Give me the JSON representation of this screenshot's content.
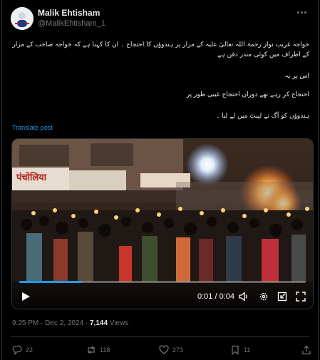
{
  "author": {
    "name": "Malik Ehtisham",
    "handle": "@MalikEhtisham_1"
  },
  "post": {
    "lines": [
      "خواجہ غریب نواز رحمۃ اللہ تعالیٰ علیہ کے مزار پر ہندوؤں کا احتجاج ۔ ان کا کہنا ہے کہ خواجہ صاحب کے مزار کے اطراف میں کوئی مندر دفن ہے",
      "اس پر یہ",
      "احتجاج کر رہے تھے دوران احتجاج غیبی طور پر",
      "ہندوؤں کو آگ نے لپیٹ میں لے لیا ۔"
    ],
    "translate_label": "Translate post"
  },
  "video": {
    "time_label": "0:01 / 0:04",
    "progress": 0.22,
    "sign_text": "पंचोलिया"
  },
  "meta": {
    "time": "9:25 PM",
    "sep": "·",
    "date": "Dec 2, 2024",
    "views_count": "7,144",
    "views_label": "Views"
  },
  "actions": {
    "replies": "22",
    "reposts": "118",
    "likes": "273",
    "bookmarks": "11"
  },
  "colors": {
    "accent": "#1d9bf0",
    "muted": "#71767b",
    "text": "#e7e9ea",
    "border": "#2f3336"
  }
}
